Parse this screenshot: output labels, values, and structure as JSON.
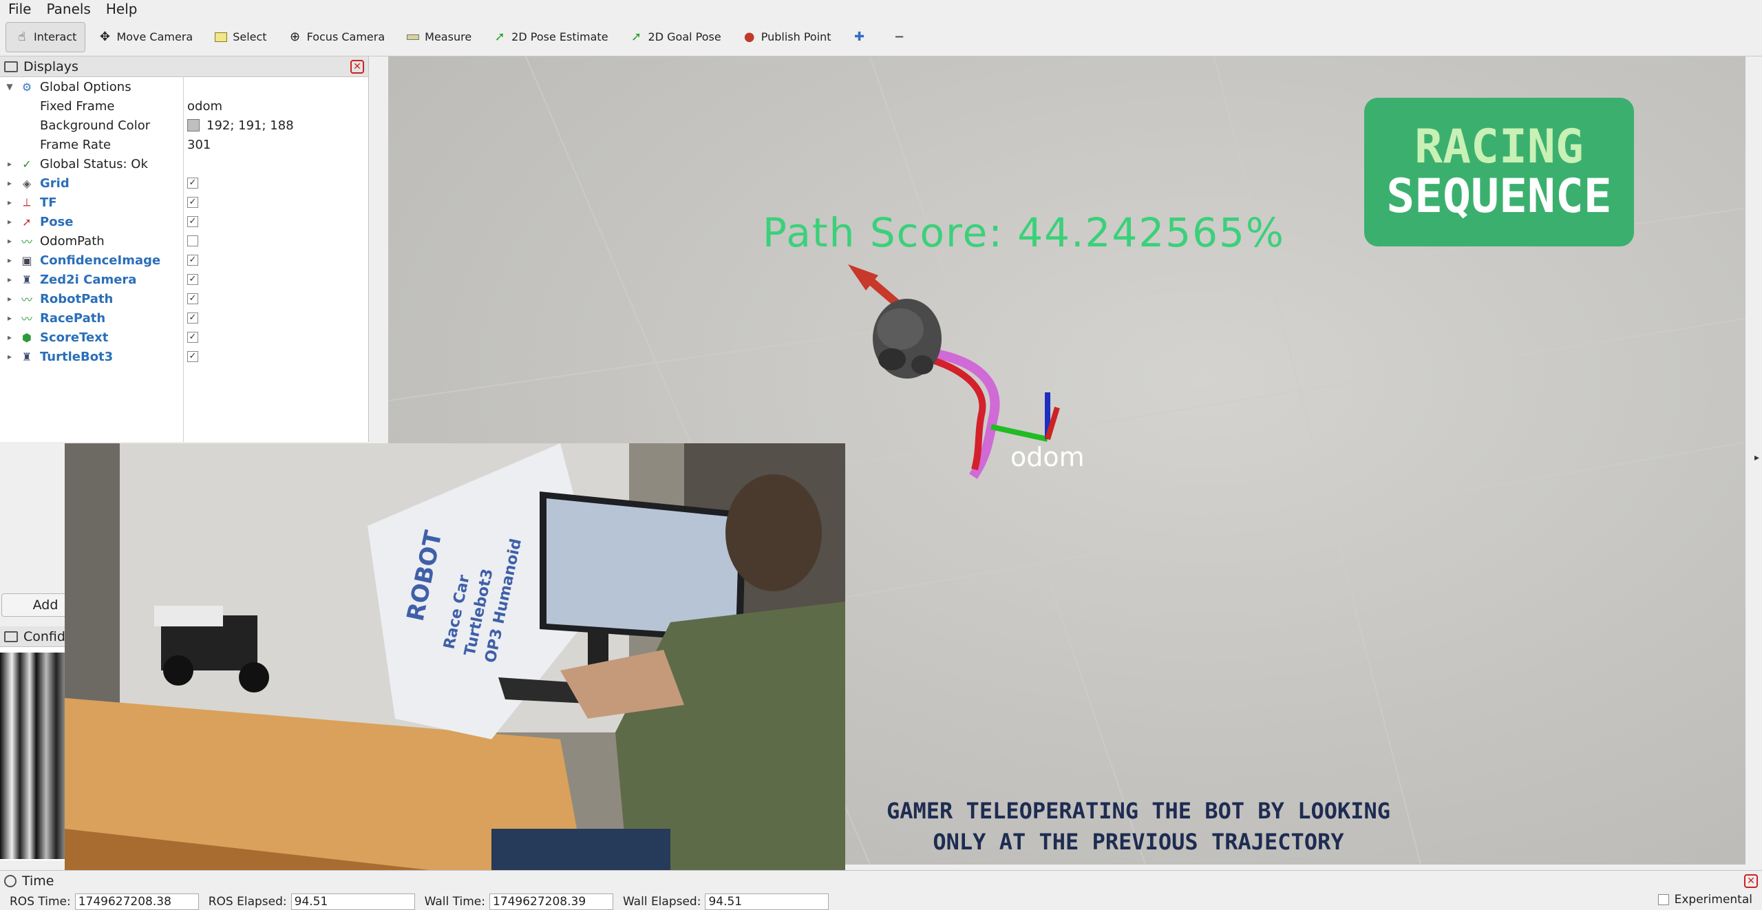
{
  "menu": [
    "File",
    "Panels",
    "Help"
  ],
  "toolbar": {
    "tools": [
      {
        "label": "Interact",
        "icon": "hand-pointer-icon",
        "active": true
      },
      {
        "label": "Move Camera",
        "icon": "move-camera-icon"
      },
      {
        "label": "Select",
        "icon": "select-box-icon"
      },
      {
        "label": "Focus Camera",
        "icon": "focus-target-icon"
      },
      {
        "label": "Measure",
        "icon": "ruler-icon"
      },
      {
        "label": "2D Pose Estimate",
        "icon": "green-arrow-icon"
      },
      {
        "label": "2D Goal Pose",
        "icon": "green-arrow-icon"
      },
      {
        "label": "Publish Point",
        "icon": "map-pin-icon"
      }
    ],
    "add_icon": "plus-icon",
    "remove_icon": "minus-icon"
  },
  "displays": {
    "title": "Displays",
    "global_options": {
      "label": "Global Options",
      "fixed_frame": {
        "label": "Fixed Frame",
        "value": "odom"
      },
      "background_color": {
        "label": "Background Color",
        "value": "192; 191; 188",
        "swatch": "#c0bfbc"
      },
      "frame_rate": {
        "label": "Frame Rate",
        "value": "301"
      }
    },
    "global_status": "Global Status: Ok",
    "items": [
      {
        "label": "Grid",
        "checked": true,
        "bold": true,
        "icon": "grid-icon"
      },
      {
        "label": "TF",
        "checked": true,
        "bold": true,
        "icon": "tf-axes-icon"
      },
      {
        "label": "Pose",
        "checked": true,
        "bold": true,
        "icon": "pose-arrow-icon"
      },
      {
        "label": "OdomPath",
        "checked": false,
        "bold": false,
        "icon": "path-icon"
      },
      {
        "label": "ConfidenceImage",
        "checked": true,
        "bold": true,
        "icon": "image-icon"
      },
      {
        "label": "Zed2i Camera",
        "checked": true,
        "bold": true,
        "icon": "robot-model-icon"
      },
      {
        "label": "RobotPath",
        "checked": true,
        "bold": true,
        "icon": "path-icon"
      },
      {
        "label": "RacePath",
        "checked": true,
        "bold": true,
        "icon": "path-icon"
      },
      {
        "label": "ScoreText",
        "checked": true,
        "bold": true,
        "icon": "marker-cube-icon"
      },
      {
        "label": "TurtleBot3",
        "checked": true,
        "bold": true,
        "icon": "robot-model-icon"
      }
    ],
    "add_button": "Add"
  },
  "confidence_panel": {
    "title": "Confid"
  },
  "viewport": {
    "score_text": "Path  Score:  44.242565%",
    "frame_label": "odom",
    "badge_line1": "RACING",
    "badge_line2": "SEQUENCE",
    "badge_color": "#3bb06e",
    "caption_line1": "GAMER TELEOPERATING THE BOT BY LOOKING",
    "caption_line2": "ONLY AT THE PREVIOUS TRAJECTORY"
  },
  "video_inset": {
    "poster_text": [
      "ROBOT",
      "Race Car",
      "Turtlebot3",
      "OP3 Humanoid"
    ]
  },
  "time_panel": {
    "title": "Time",
    "ros_time_label": "ROS Time:",
    "ros_time": "1749627208.38",
    "ros_elapsed_label": "ROS Elapsed:",
    "ros_elapsed": "94.51",
    "wall_time_label": "Wall Time:",
    "wall_time": "1749627208.39",
    "wall_elapsed_label": "Wall Elapsed:",
    "wall_elapsed": "94.51",
    "experimental": "Experimental"
  }
}
